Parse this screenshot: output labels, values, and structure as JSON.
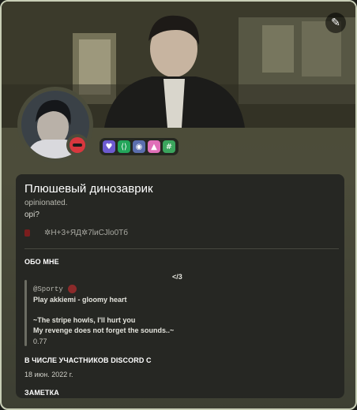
{
  "profile": {
    "display_name": "Плюшевый динозаврик",
    "username": "opinionated.",
    "pronouns": "opi?",
    "custom_status": "✲H+3+ЯД✲7lиCJlo0Tб"
  },
  "badges": [
    "hypesquad-icon",
    "active-developer-icon",
    "nitro-icon",
    "triangle-icon",
    "hashtag-icon"
  ],
  "about": {
    "title": "ОБО МНЕ",
    "lines": [
      "</3",
      "@Sporty",
      "Play akkiemi - gloomy heart",
      "~The stripe howls, I'll hurt you",
      "My revenge does not forget the sounds..~",
      "0.77"
    ]
  },
  "member_since": {
    "title": "В ЧИСЛЕ УЧАСТНИКОВ DISCORD С",
    "date": "18 июн. 2022 г."
  },
  "note": {
    "title": "ЗАМЕТКА"
  },
  "colors": {
    "frame_border": "#c8ceb6",
    "status_dnd": "#d8373e",
    "card_bg": "#262723"
  }
}
